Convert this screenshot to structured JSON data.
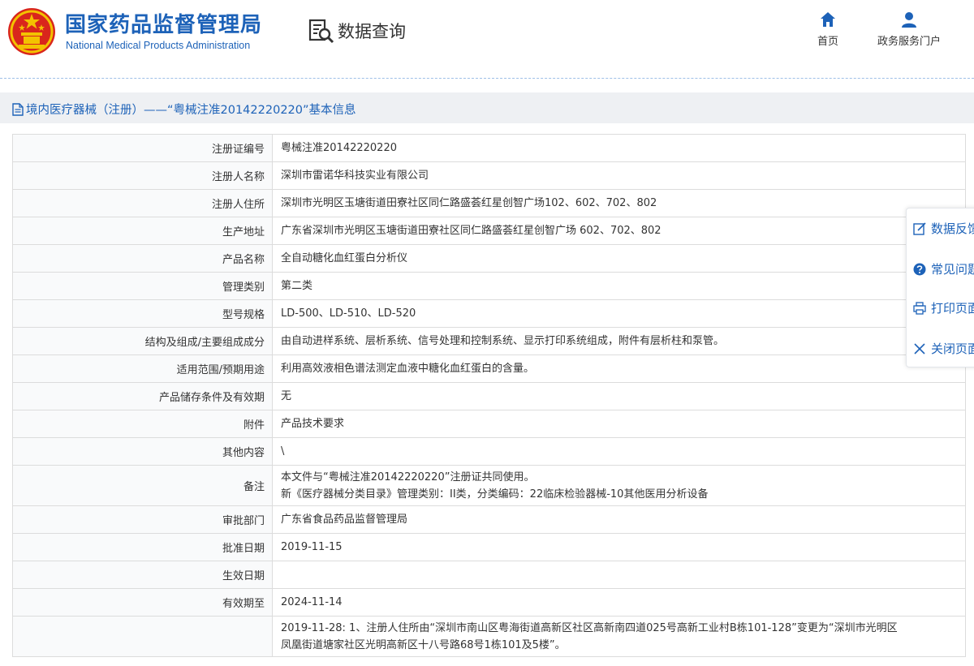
{
  "header": {
    "logo_cn": "国家药品监督管理局",
    "logo_en": "National Medical Products Administration",
    "data_query": "数据查询",
    "nav": [
      {
        "label": "首页",
        "icon": "home-icon"
      },
      {
        "label": "政务服务门户",
        "icon": "user-icon"
      }
    ]
  },
  "title_bar": {
    "icon": "document-icon",
    "text": "境内医疗器械（注册）——“粤械注准20142220220”基本信息"
  },
  "rows": [
    {
      "label": "注册证编号",
      "value": "粤械注准20142220220"
    },
    {
      "label": "注册人名称",
      "value": "深圳市雷诺华科技实业有限公司"
    },
    {
      "label": "注册人住所",
      "value": "深圳市光明区玉塘街道田寮社区同仁路盛荟红星创智广场102、602、702、802"
    },
    {
      "label": "生产地址",
      "value": "广东省深圳市光明区玉塘街道田寮社区同仁路盛荟红星创智广场 602、702、802"
    },
    {
      "label": "产品名称",
      "value": "全自动糖化血红蛋白分析仪"
    },
    {
      "label": "管理类别",
      "value": "第二类"
    },
    {
      "label": "型号规格",
      "value": "LD-500、LD-510、LD-520"
    },
    {
      "label": "结构及组成/主要组成成分",
      "value": "由自动进样系统、层析系统、信号处理和控制系统、显示打印系统组成，附件有层析柱和泵管。"
    },
    {
      "label": "适用范围/预期用途",
      "value": "利用高效液相色谱法测定血液中糖化血红蛋白的含量。"
    },
    {
      "label": "产品储存条件及有效期",
      "value": "无"
    },
    {
      "label": "附件",
      "value": "产品技术要求"
    },
    {
      "label": "其他内容",
      "value": "\\"
    },
    {
      "label": "备注",
      "value_line1": "本文件与“粤械注准20142220220”注册证共同使用。",
      "value_line2": "新《医疗器械分类目录》管理类别：II类，分类编码：22临床检验器械-10其他医用分析设备"
    },
    {
      "label": "审批部门",
      "value": "广东省食品药品监督管理局"
    },
    {
      "label": "批准日期",
      "value": "2019-11-15"
    },
    {
      "label": "生效日期",
      "value": ""
    },
    {
      "label": "有效期至",
      "value": "2024-11-14"
    },
    {
      "label": "",
      "value_line1": "2019-11-28: 1、注册人住所由“深圳市南山区粤海街道高新区社区高新南四道025号高新工业村B栋101-128”变更为“深圳市光明区",
      "value_line2": "凤凰街道塘家社区光明高新区十八号路68号1栋101及5楼”。"
    }
  ],
  "side_panel": [
    {
      "label": "数据反馈",
      "icon": "edit-icon"
    },
    {
      "label": "常见问题",
      "icon": "question-icon"
    },
    {
      "label": "打印页面",
      "icon": "print-icon"
    },
    {
      "label": "关闭页面",
      "icon": "close-icon"
    }
  ],
  "colors": {
    "brand_blue": "#1d62b8",
    "emblem_red": "#d9261c",
    "emblem_gold": "#f3c200"
  }
}
